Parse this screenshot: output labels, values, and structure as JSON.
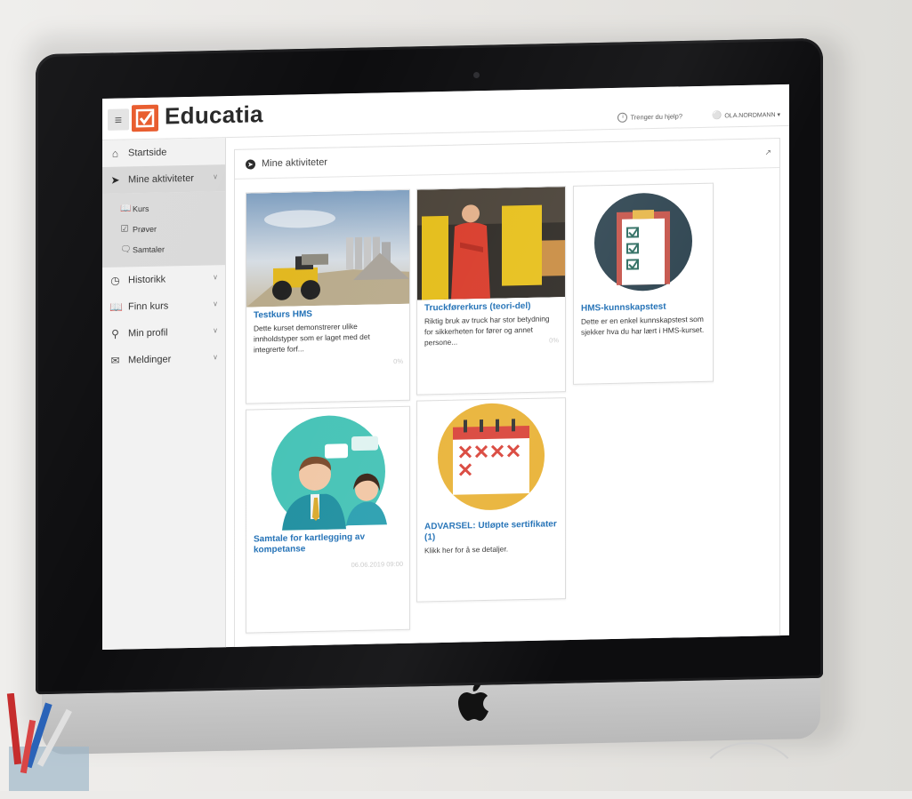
{
  "app": {
    "logo_text": "Educatia",
    "brand_color": "#e8592a",
    "link_color": "#1f6fb5"
  },
  "header": {
    "menu_icon": "hamburger-icon",
    "help_label": "Trenger du hjelp?",
    "user_label": "OLA.NORDMANN ▾"
  },
  "sidebar": {
    "items": [
      {
        "label": "Startside",
        "icon": "home-icon"
      },
      {
        "label": "Mine aktiviteter",
        "icon": "arrow-circle-icon"
      },
      {
        "label": "Historikk",
        "icon": "history-icon"
      },
      {
        "label": "Finn kurs",
        "icon": "book-icon"
      },
      {
        "label": "Min profil",
        "icon": "user-icon"
      },
      {
        "label": "Meldinger",
        "icon": "mail-icon"
      }
    ],
    "subitems": [
      {
        "label": "Kurs",
        "icon": "book-icon"
      },
      {
        "label": "Prøver",
        "icon": "checklist-icon"
      },
      {
        "label": "Samtaler",
        "icon": "chat-icon"
      }
    ]
  },
  "panel": {
    "title": "Mine aktiviteter"
  },
  "cards": [
    {
      "title": "Testkurs HMS",
      "desc": "Dette kurset demonstrerer ulike innholdstyper som er laget med det integrerte forf...",
      "meta": "0%"
    },
    {
      "title": "Truckførerkurs (teori-del)",
      "desc": "Riktig bruk av truck har stor betydning for sikkerheten for fører og annet persone...",
      "meta": "0%"
    },
    {
      "title": "HMS-kunnskapstest",
      "desc": "Dette er en enkel kunnskapstest som sjekker hva du har lært i HMS-kurset.",
      "meta": ""
    },
    {
      "title": "Samtale for kartlegging av kompetanse",
      "desc": "",
      "meta": "06.06.2019 09:00"
    },
    {
      "title": "ADVARSEL: Utløpte sertifikater (1)",
      "desc": "Klikk her for å se detaljer.",
      "meta": ""
    }
  ]
}
